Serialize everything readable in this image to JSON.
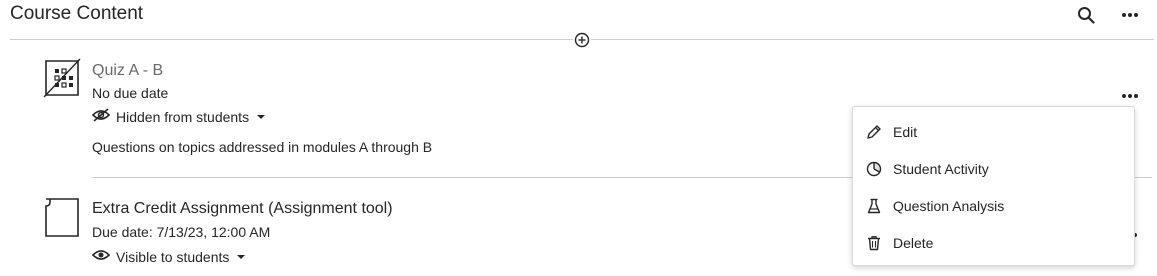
{
  "header": {
    "title": "Course Content",
    "search_icon": "search-icon",
    "more_icon": "more-options-icon"
  },
  "items": [
    {
      "icon": "test-document-icon",
      "title": "Quiz A - B",
      "due": "No due date",
      "visibility": "Hidden from students",
      "visibility_icon": "eye-slash-icon",
      "description": "Questions on topics addressed in modules A through B"
    },
    {
      "icon": "assignment-document-icon",
      "title": "Extra Credit Assignment (Assignment tool)",
      "due": "Due date: 7/13/23, 12:00 AM",
      "visibility": "Visible to students",
      "visibility_icon": "eye-icon"
    }
  ],
  "context_menu": {
    "items": [
      {
        "label": "Edit",
        "icon": "pencil-icon"
      },
      {
        "label": "Student Activity",
        "icon": "pie-chart-icon"
      },
      {
        "label": "Question Analysis",
        "icon": "flask-icon"
      },
      {
        "label": "Delete",
        "icon": "trash-icon"
      }
    ]
  },
  "colors": {
    "text": "#262626",
    "hidden_title": "#6b6b6b",
    "divider": "#cdcdcd"
  }
}
